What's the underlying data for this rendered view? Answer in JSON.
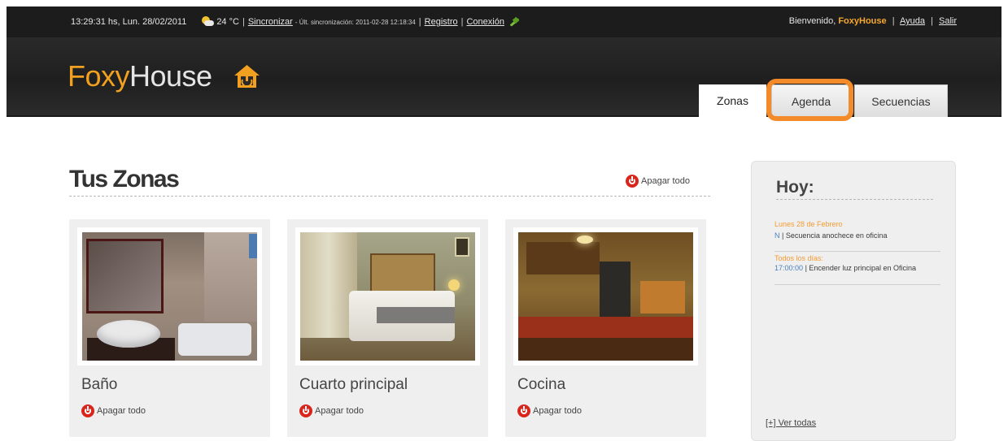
{
  "topbar": {
    "time": "13:29:31 hs, Lun. 28/02/2011",
    "temperature": "24 °C",
    "sync_link": "Sincronizar",
    "last_sync": "- Últ. sincronización: 2011-02-28 12:18:34",
    "register_link": "Registro",
    "connection_link": "Conexión",
    "welcome": "Bienvenido,",
    "username": "FoxyHouse",
    "help_link": "Ayuda",
    "logout_link": "Salir",
    "separator": "|"
  },
  "logo": {
    "foxy": "Foxy",
    "house": "House"
  },
  "tabs": [
    {
      "label": "Zonas"
    },
    {
      "label": "Agenda"
    },
    {
      "label": "Secuencias"
    }
  ],
  "zones": {
    "title": "Tus Zonas",
    "turn_off_all": "Apagar todo",
    "items": [
      {
        "name": "Baño",
        "action": "Apagar todo"
      },
      {
        "name": "Cuarto principal",
        "action": "Apagar todo"
      },
      {
        "name": "Cocina",
        "action": "Apagar todo"
      }
    ]
  },
  "sidebar": {
    "title": "Hoy:",
    "events": [
      {
        "date": "Lunes 28 de Febrero",
        "time": "N",
        "text": "| Secuencia anochece en oficina"
      },
      {
        "date": "Todos los días:",
        "time": "17:00:00",
        "text": "| Encender luz principal en Oficina"
      }
    ],
    "see_all": "[+] Ver todas"
  },
  "colors": {
    "accent": "#f7a82c",
    "highlight": "#f48b2a",
    "power": "#d9261c"
  }
}
